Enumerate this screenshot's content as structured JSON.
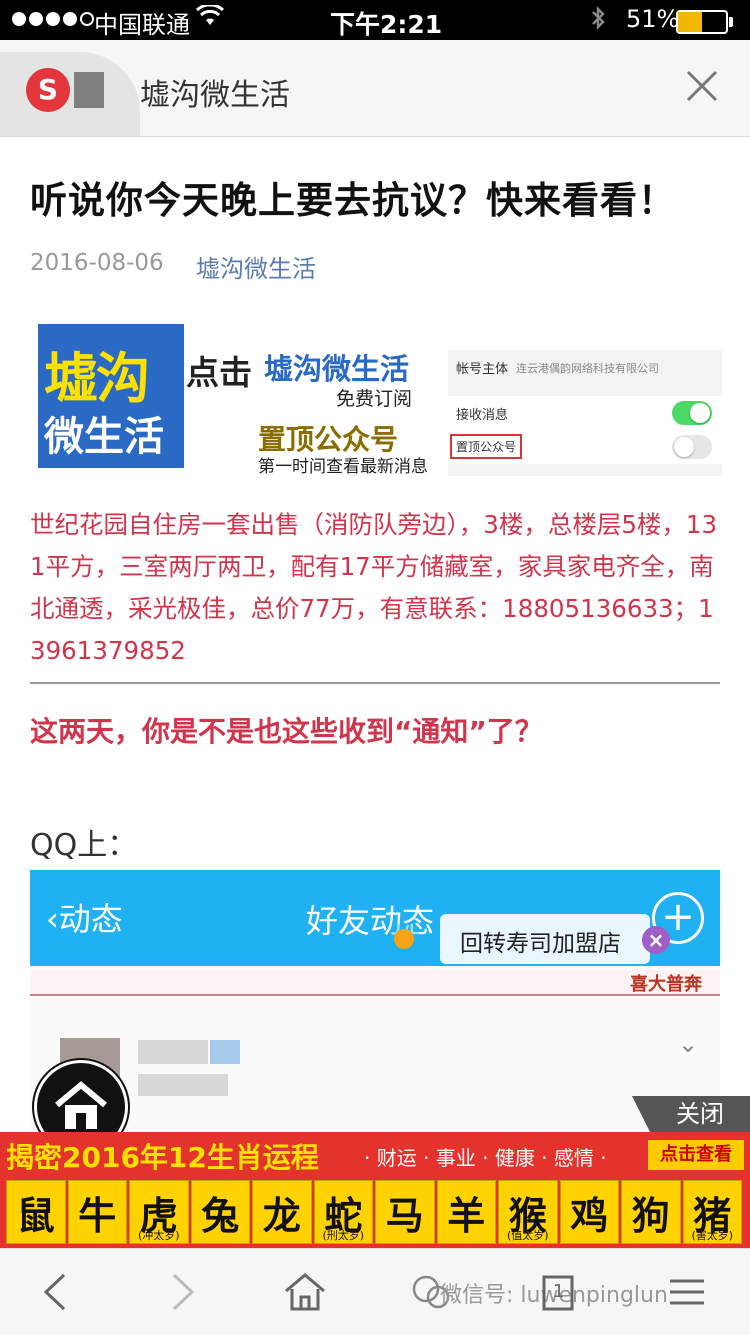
{
  "status_bar": {
    "carrier": "中国联通",
    "time": "下午2:21",
    "battery": "51%"
  },
  "header": {
    "logo_letter": "S",
    "title": "墟沟微生活"
  },
  "article": {
    "title": "听说你今天晚上要去抗议？快来看看！",
    "date": "2016-08-06",
    "account": "墟沟微生活"
  },
  "banner": {
    "logo_line1": "墟沟",
    "logo_line2": "微生活",
    "click": "点击",
    "name": "墟沟微生活",
    "free": "免费订阅",
    "pin": "置顶公众号",
    "first": "第一时间查看最新消息",
    "settings": {
      "owner_label": "帐号主体",
      "owner_value": "连云港偶韵网络科技有限公司",
      "receive_label": "接收消息",
      "pin_label": "置顶公众号"
    }
  },
  "ad_text": "世纪花园自住房一套出售（消防队旁边），3楼，总楼层5楼，131平方，三室两厅两卫，配有17平方储藏室，家具家电齐全，南北通透，采光极佳，总价77万，有意联系：18805136633；13961379852",
  "question": "这两天，你是不是也这些收到“通知”了？",
  "qq_label": "QQ上：",
  "qq_shot": {
    "back": "‹动态",
    "title": "好友动态",
    "banner": "喜大普奔"
  },
  "tooltip": "回转寿司加盟店",
  "close_ad": "关闭",
  "adbar": {
    "title": "揭密2016年12生肖运程",
    "tags": "· 财运 · 事业 · 健康 · 感情 ·",
    "button": "点击查看",
    "zodiac": [
      {
        "ch": "鼠",
        "sub": ""
      },
      {
        "ch": "牛",
        "sub": ""
      },
      {
        "ch": "虎",
        "sub": "(冲太岁)"
      },
      {
        "ch": "兔",
        "sub": ""
      },
      {
        "ch": "龙",
        "sub": ""
      },
      {
        "ch": "蛇",
        "sub": "(刑太岁)"
      },
      {
        "ch": "马",
        "sub": ""
      },
      {
        "ch": "羊",
        "sub": ""
      },
      {
        "ch": "猴",
        "sub": "(值太岁)"
      },
      {
        "ch": "鸡",
        "sub": ""
      },
      {
        "ch": "狗",
        "sub": ""
      },
      {
        "ch": "猪",
        "sub": "(害太岁)"
      }
    ]
  },
  "toolbar": {
    "tab_count": "1",
    "watermark": "微信号: luwenpinglun"
  },
  "colors": {
    "accent_red": "#d0354c",
    "qq_blue": "#1fb1f1",
    "toggle_green": "#4cd964",
    "ad_red": "#e4322c",
    "ad_yellow": "#ffd200"
  }
}
